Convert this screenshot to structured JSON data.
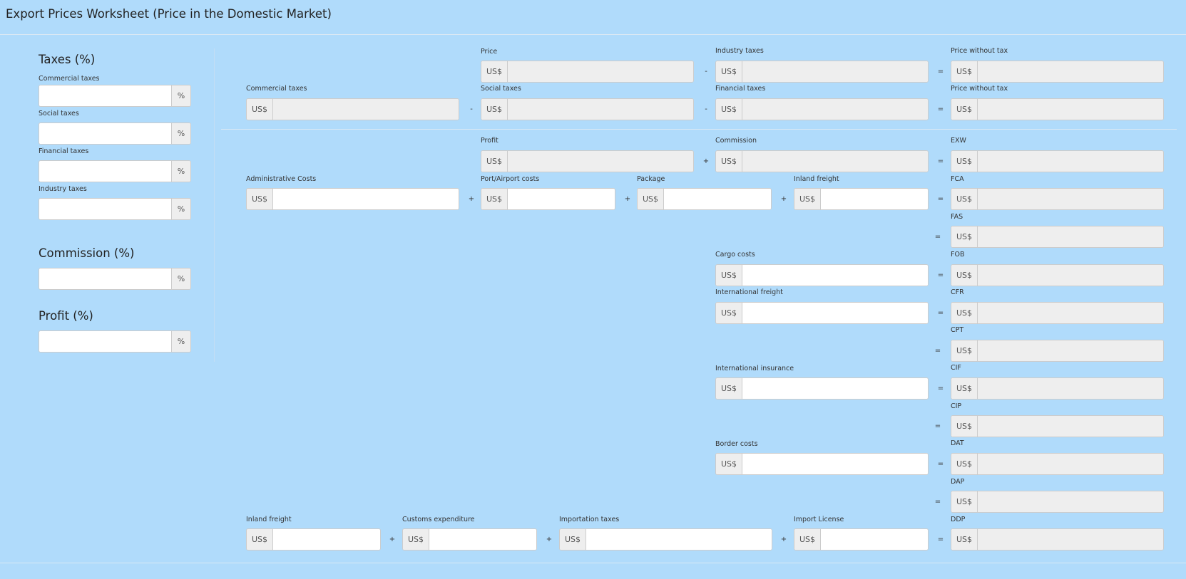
{
  "title": "Export Prices Worksheet (Price in the Domestic Market)",
  "sidebar": {
    "taxes_title": "Taxes (%)",
    "commercial_label": "Commercial taxes",
    "social_label": "Social taxes",
    "financial_label": "Financial taxes",
    "industry_label": "Industry taxes",
    "commission_title": "Commission (%)",
    "profit_title": "Profit (%)",
    "percent": "%"
  },
  "currency": "US$",
  "ops": {
    "minus": "-",
    "plus": "+",
    "equals": "="
  },
  "labels": {
    "price": "Price",
    "industry_taxes": "Industry taxes",
    "price_without_tax": "Price without tax",
    "commercial_taxes": "Commercial taxes",
    "social_taxes": "Social taxes",
    "financial_taxes": "Financial taxes",
    "profit": "Profit",
    "commission": "Commission",
    "exw": "EXW",
    "administrative_costs": "Administrative Costs",
    "port_airport_costs": "Port/Airport costs",
    "package": "Package",
    "inland_freight": "Inland freight",
    "fca": "FCA",
    "fas": "FAS",
    "cargo_costs": "Cargo costs",
    "fob": "FOB",
    "international_freight": "International freight",
    "cfr": "CFR",
    "cpt": "CPT",
    "international_insurance": "International insurance",
    "cif": "CIF",
    "cip": "CIP",
    "border_costs": "Border costs",
    "dat": "DAT",
    "dap": "DAP",
    "ddp": "DDP",
    "customs_expenditure": "Customs expenditure",
    "importation_taxes": "Importation taxes",
    "import_license": "Import License"
  }
}
